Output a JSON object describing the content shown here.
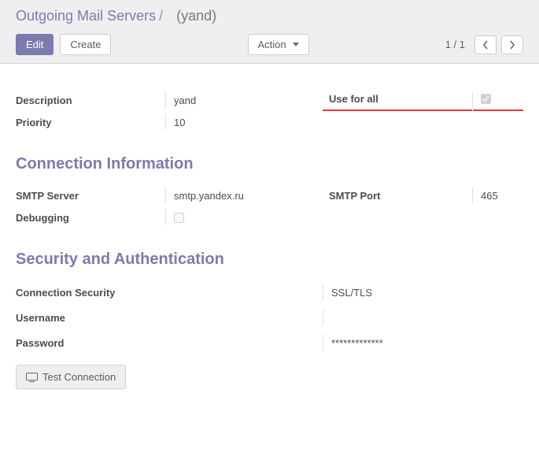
{
  "breadcrumb": {
    "root": "Outgoing Mail Servers",
    "sep": "/",
    "current": "(yand)"
  },
  "toolbar": {
    "edit": "Edit",
    "create": "Create",
    "action": "Action",
    "pager": "1 / 1"
  },
  "fields": {
    "description_label": "Description",
    "description_value": "yand",
    "priority_label": "Priority",
    "priority_value": "10",
    "use_for_all_label": "Use for all",
    "use_for_all_checked": true
  },
  "connection": {
    "title": "Connection Information",
    "smtp_server_label": "SMTP Server",
    "smtp_server_value": "smtp.yandex.ru",
    "smtp_port_label": "SMTP Port",
    "smtp_port_value": "465",
    "debugging_label": "Debugging",
    "debugging_checked": false
  },
  "security": {
    "title": "Security and Authentication",
    "conn_sec_label": "Connection Security",
    "conn_sec_value": "SSL/TLS",
    "username_label": "Username",
    "username_value": "",
    "password_label": "Password",
    "password_value": "*************",
    "test_connection": "Test Connection"
  }
}
